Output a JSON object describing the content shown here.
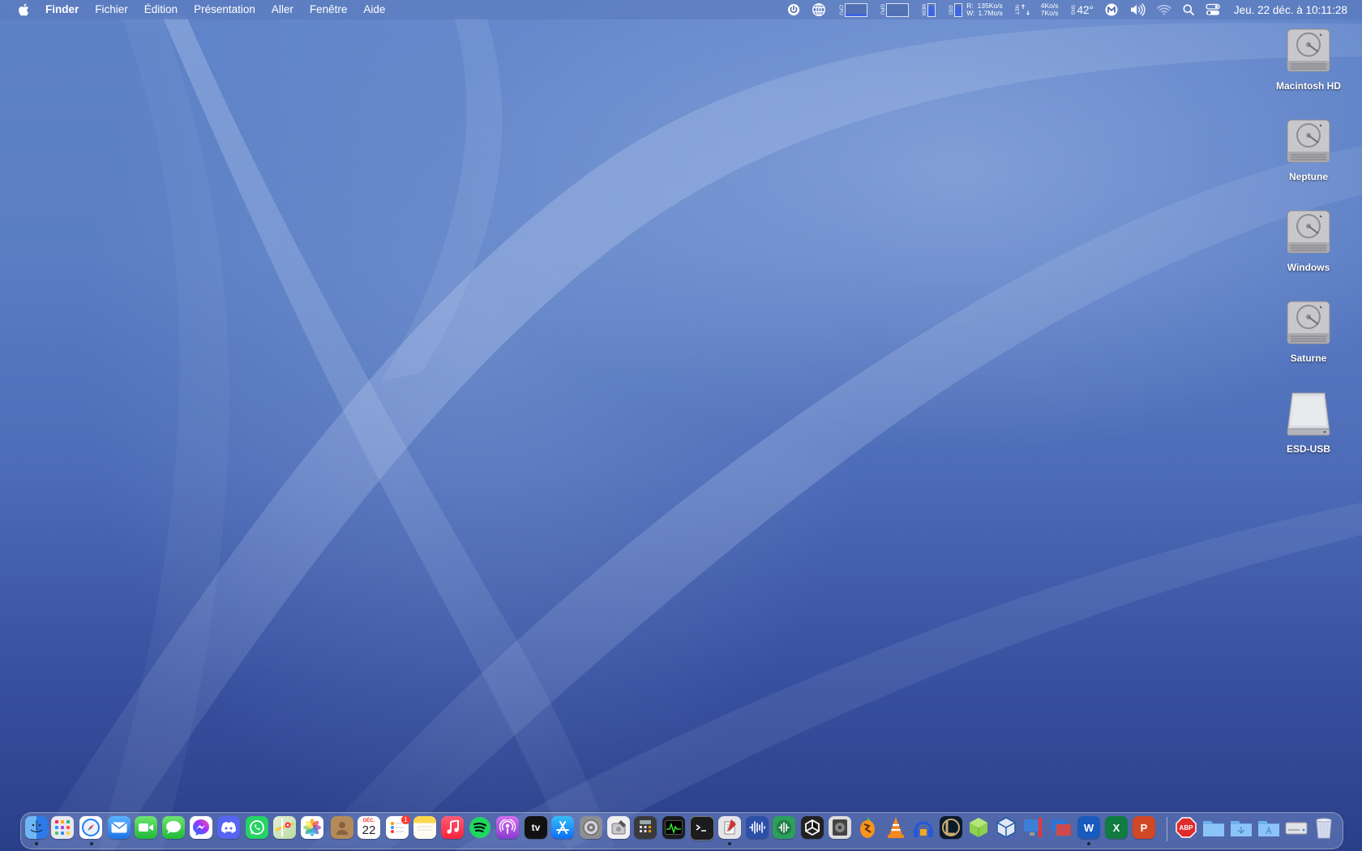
{
  "menubar": {
    "app_name": "Finder",
    "menus": [
      "Fichier",
      "Édition",
      "Présentation",
      "Aller",
      "Fenêtre",
      "Aide"
    ],
    "status": {
      "cpu_label": "CPU",
      "gpu_label": "GPU",
      "mem_label": "MEM",
      "ssd_label": "SSD",
      "disk_read_prefix": "R:",
      "disk_write_prefix": "W:",
      "disk_read": "135Ko/s",
      "disk_write": "1.7Mo/s",
      "net_label": "NET",
      "net_up": "4Ko/s",
      "net_down": "7Ko/s",
      "sensor_label": "SNS",
      "temperature": "42°",
      "clock": "Jeu. 22 déc. à  10:11:28"
    }
  },
  "desktop_icons": [
    {
      "label": "Macintosh HD",
      "icon": "hard-drive-icon"
    },
    {
      "label": "Neptune",
      "icon": "hard-drive-icon"
    },
    {
      "label": "Windows",
      "icon": "hard-drive-icon"
    },
    {
      "label": "Saturne",
      "icon": "hard-drive-icon"
    },
    {
      "label": "ESD-USB",
      "icon": "usb-drive-icon"
    }
  ],
  "dock": {
    "calendar_month": "DÉC.",
    "calendar_day": "22",
    "reminders_badge": "1",
    "tv_label": "tv",
    "abp_label": "ABP",
    "apps": [
      "finder-icon",
      "launchpad-icon",
      "safari-icon",
      "mail-icon",
      "facetime-icon",
      "messages-icon",
      "messenger-icon",
      "discord-icon",
      "whatsapp-icon",
      "maps-icon",
      "photos-icon",
      "contacts-icon",
      "calendar-icon",
      "reminders-icon",
      "notes-icon",
      "music-icon",
      "spotify-icon",
      "podcasts-icon",
      "apple-tv-icon",
      "app-store-icon",
      "system-preferences-icon",
      "disk-utility-icon",
      "calculator-icon",
      "activity-monitor-icon",
      "terminal-icon",
      "script-editor-icon",
      "audio-app-icon",
      "sound-app-icon",
      "unity-icon",
      "disk-icon",
      "fl-studio-icon",
      "vlc-icon",
      "headphones-app-icon",
      "league-of-legends-icon",
      "cube-app-icon",
      "virtualbox-icon",
      "screen-app-icon",
      "parallels-icon",
      "word-icon",
      "excel-icon",
      "powerpoint-icon",
      "adblock-plus-icon",
      "documents-folder-icon",
      "downloads-folder-icon",
      "applications-folder-icon",
      "drive-icon",
      "trash-icon"
    ]
  }
}
